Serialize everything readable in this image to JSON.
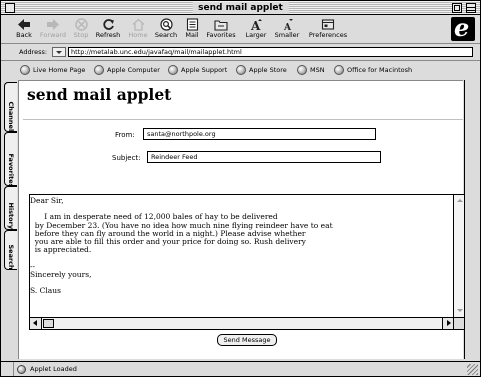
{
  "window": {
    "title": "send mail applet"
  },
  "toolbar": {
    "buttons": [
      {
        "label": "Back",
        "icon": "back-arrow-icon",
        "enabled": true
      },
      {
        "label": "Forward",
        "icon": "forward-arrow-icon",
        "enabled": false
      },
      {
        "label": "Stop",
        "icon": "stop-icon",
        "enabled": false
      },
      {
        "label": "Refresh",
        "icon": "refresh-icon",
        "enabled": true
      },
      {
        "label": "Home",
        "icon": "home-icon",
        "enabled": false
      },
      {
        "label": "Search",
        "icon": "search-icon",
        "enabled": true
      },
      {
        "label": "Mail",
        "icon": "mail-icon",
        "enabled": true
      },
      {
        "label": "Favorites",
        "icon": "favorites-icon",
        "enabled": true
      },
      {
        "label": "Larger",
        "icon": "larger-text-icon",
        "enabled": true
      },
      {
        "label": "Smaller",
        "icon": "smaller-text-icon",
        "enabled": true
      },
      {
        "label": "Preferences",
        "icon": "preferences-icon",
        "enabled": true
      }
    ]
  },
  "address": {
    "label": "Address:",
    "url": "http://metalab.unc.edu/javafaq/mail/mailapplet.html"
  },
  "favorites": [
    "Live Home Page",
    "Apple Computer",
    "Apple Support",
    "Apple Store",
    "MSN",
    "Office for Macintosh"
  ],
  "sidetabs": [
    "Channels",
    "Favorites",
    "History",
    "Search"
  ],
  "page": {
    "title": "send mail applet",
    "from_label": "From:",
    "from_value": "santa@northpole.org",
    "subject_label": "Subject:",
    "subject_value": "Reindeer Feed",
    "message": "Dear Sir,\n\n      I am in desperate need of 12,000 bales of hay to be delivered\n  by December 23. (You have no idea how much nine flying reindeer have to eat\n  before they can fly around the world in a night.) Please advise whether\n  you are able to fill this order and your price for doing so. Rush delivery\n  is appreciated.\n\n--\nSincerely yours,\n\nS. Claus",
    "send_label": "Send Message"
  },
  "status": {
    "text": "Applet Loaded"
  }
}
